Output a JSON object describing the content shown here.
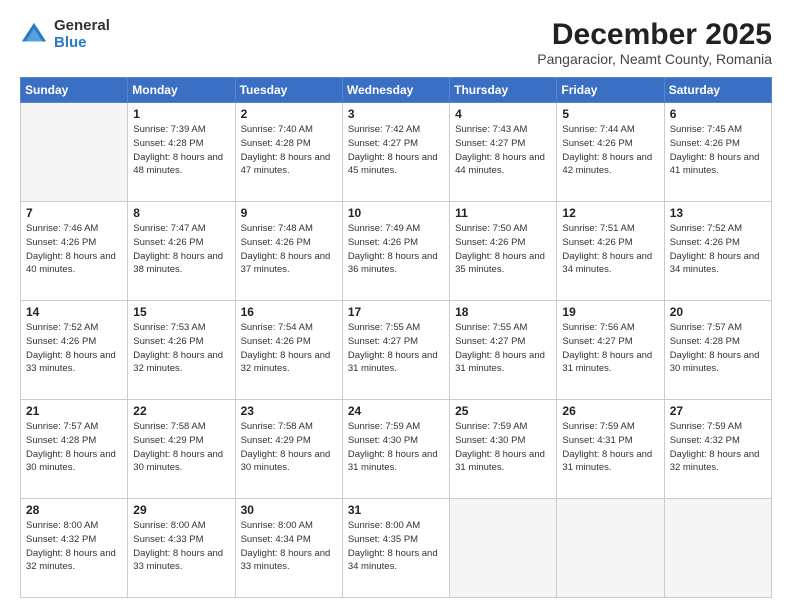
{
  "header": {
    "logo_line1": "General",
    "logo_line2": "Blue",
    "month": "December 2025",
    "location": "Pangaracior, Neamt County, Romania"
  },
  "calendar": {
    "day_headers": [
      "Sunday",
      "Monday",
      "Tuesday",
      "Wednesday",
      "Thursday",
      "Friday",
      "Saturday"
    ],
    "weeks": [
      [
        {
          "day": "",
          "info": ""
        },
        {
          "day": "1",
          "info": "Sunrise: 7:39 AM\nSunset: 4:28 PM\nDaylight: 8 hours\nand 48 minutes."
        },
        {
          "day": "2",
          "info": "Sunrise: 7:40 AM\nSunset: 4:28 PM\nDaylight: 8 hours\nand 47 minutes."
        },
        {
          "day": "3",
          "info": "Sunrise: 7:42 AM\nSunset: 4:27 PM\nDaylight: 8 hours\nand 45 minutes."
        },
        {
          "day": "4",
          "info": "Sunrise: 7:43 AM\nSunset: 4:27 PM\nDaylight: 8 hours\nand 44 minutes."
        },
        {
          "day": "5",
          "info": "Sunrise: 7:44 AM\nSunset: 4:26 PM\nDaylight: 8 hours\nand 42 minutes."
        },
        {
          "day": "6",
          "info": "Sunrise: 7:45 AM\nSunset: 4:26 PM\nDaylight: 8 hours\nand 41 minutes."
        }
      ],
      [
        {
          "day": "7",
          "info": "Sunrise: 7:46 AM\nSunset: 4:26 PM\nDaylight: 8 hours\nand 40 minutes."
        },
        {
          "day": "8",
          "info": "Sunrise: 7:47 AM\nSunset: 4:26 PM\nDaylight: 8 hours\nand 38 minutes."
        },
        {
          "day": "9",
          "info": "Sunrise: 7:48 AM\nSunset: 4:26 PM\nDaylight: 8 hours\nand 37 minutes."
        },
        {
          "day": "10",
          "info": "Sunrise: 7:49 AM\nSunset: 4:26 PM\nDaylight: 8 hours\nand 36 minutes."
        },
        {
          "day": "11",
          "info": "Sunrise: 7:50 AM\nSunset: 4:26 PM\nDaylight: 8 hours\nand 35 minutes."
        },
        {
          "day": "12",
          "info": "Sunrise: 7:51 AM\nSunset: 4:26 PM\nDaylight: 8 hours\nand 34 minutes."
        },
        {
          "day": "13",
          "info": "Sunrise: 7:52 AM\nSunset: 4:26 PM\nDaylight: 8 hours\nand 34 minutes."
        }
      ],
      [
        {
          "day": "14",
          "info": "Sunrise: 7:52 AM\nSunset: 4:26 PM\nDaylight: 8 hours\nand 33 minutes."
        },
        {
          "day": "15",
          "info": "Sunrise: 7:53 AM\nSunset: 4:26 PM\nDaylight: 8 hours\nand 32 minutes."
        },
        {
          "day": "16",
          "info": "Sunrise: 7:54 AM\nSunset: 4:26 PM\nDaylight: 8 hours\nand 32 minutes."
        },
        {
          "day": "17",
          "info": "Sunrise: 7:55 AM\nSunset: 4:27 PM\nDaylight: 8 hours\nand 31 minutes."
        },
        {
          "day": "18",
          "info": "Sunrise: 7:55 AM\nSunset: 4:27 PM\nDaylight: 8 hours\nand 31 minutes."
        },
        {
          "day": "19",
          "info": "Sunrise: 7:56 AM\nSunset: 4:27 PM\nDaylight: 8 hours\nand 31 minutes."
        },
        {
          "day": "20",
          "info": "Sunrise: 7:57 AM\nSunset: 4:28 PM\nDaylight: 8 hours\nand 30 minutes."
        }
      ],
      [
        {
          "day": "21",
          "info": "Sunrise: 7:57 AM\nSunset: 4:28 PM\nDaylight: 8 hours\nand 30 minutes."
        },
        {
          "day": "22",
          "info": "Sunrise: 7:58 AM\nSunset: 4:29 PM\nDaylight: 8 hours\nand 30 minutes."
        },
        {
          "day": "23",
          "info": "Sunrise: 7:58 AM\nSunset: 4:29 PM\nDaylight: 8 hours\nand 30 minutes."
        },
        {
          "day": "24",
          "info": "Sunrise: 7:59 AM\nSunset: 4:30 PM\nDaylight: 8 hours\nand 31 minutes."
        },
        {
          "day": "25",
          "info": "Sunrise: 7:59 AM\nSunset: 4:30 PM\nDaylight: 8 hours\nand 31 minutes."
        },
        {
          "day": "26",
          "info": "Sunrise: 7:59 AM\nSunset: 4:31 PM\nDaylight: 8 hours\nand 31 minutes."
        },
        {
          "day": "27",
          "info": "Sunrise: 7:59 AM\nSunset: 4:32 PM\nDaylight: 8 hours\nand 32 minutes."
        }
      ],
      [
        {
          "day": "28",
          "info": "Sunrise: 8:00 AM\nSunset: 4:32 PM\nDaylight: 8 hours\nand 32 minutes."
        },
        {
          "day": "29",
          "info": "Sunrise: 8:00 AM\nSunset: 4:33 PM\nDaylight: 8 hours\nand 33 minutes."
        },
        {
          "day": "30",
          "info": "Sunrise: 8:00 AM\nSunset: 4:34 PM\nDaylight: 8 hours\nand 33 minutes."
        },
        {
          "day": "31",
          "info": "Sunrise: 8:00 AM\nSunset: 4:35 PM\nDaylight: 8 hours\nand 34 minutes."
        },
        {
          "day": "",
          "info": ""
        },
        {
          "day": "",
          "info": ""
        },
        {
          "day": "",
          "info": ""
        }
      ]
    ]
  }
}
